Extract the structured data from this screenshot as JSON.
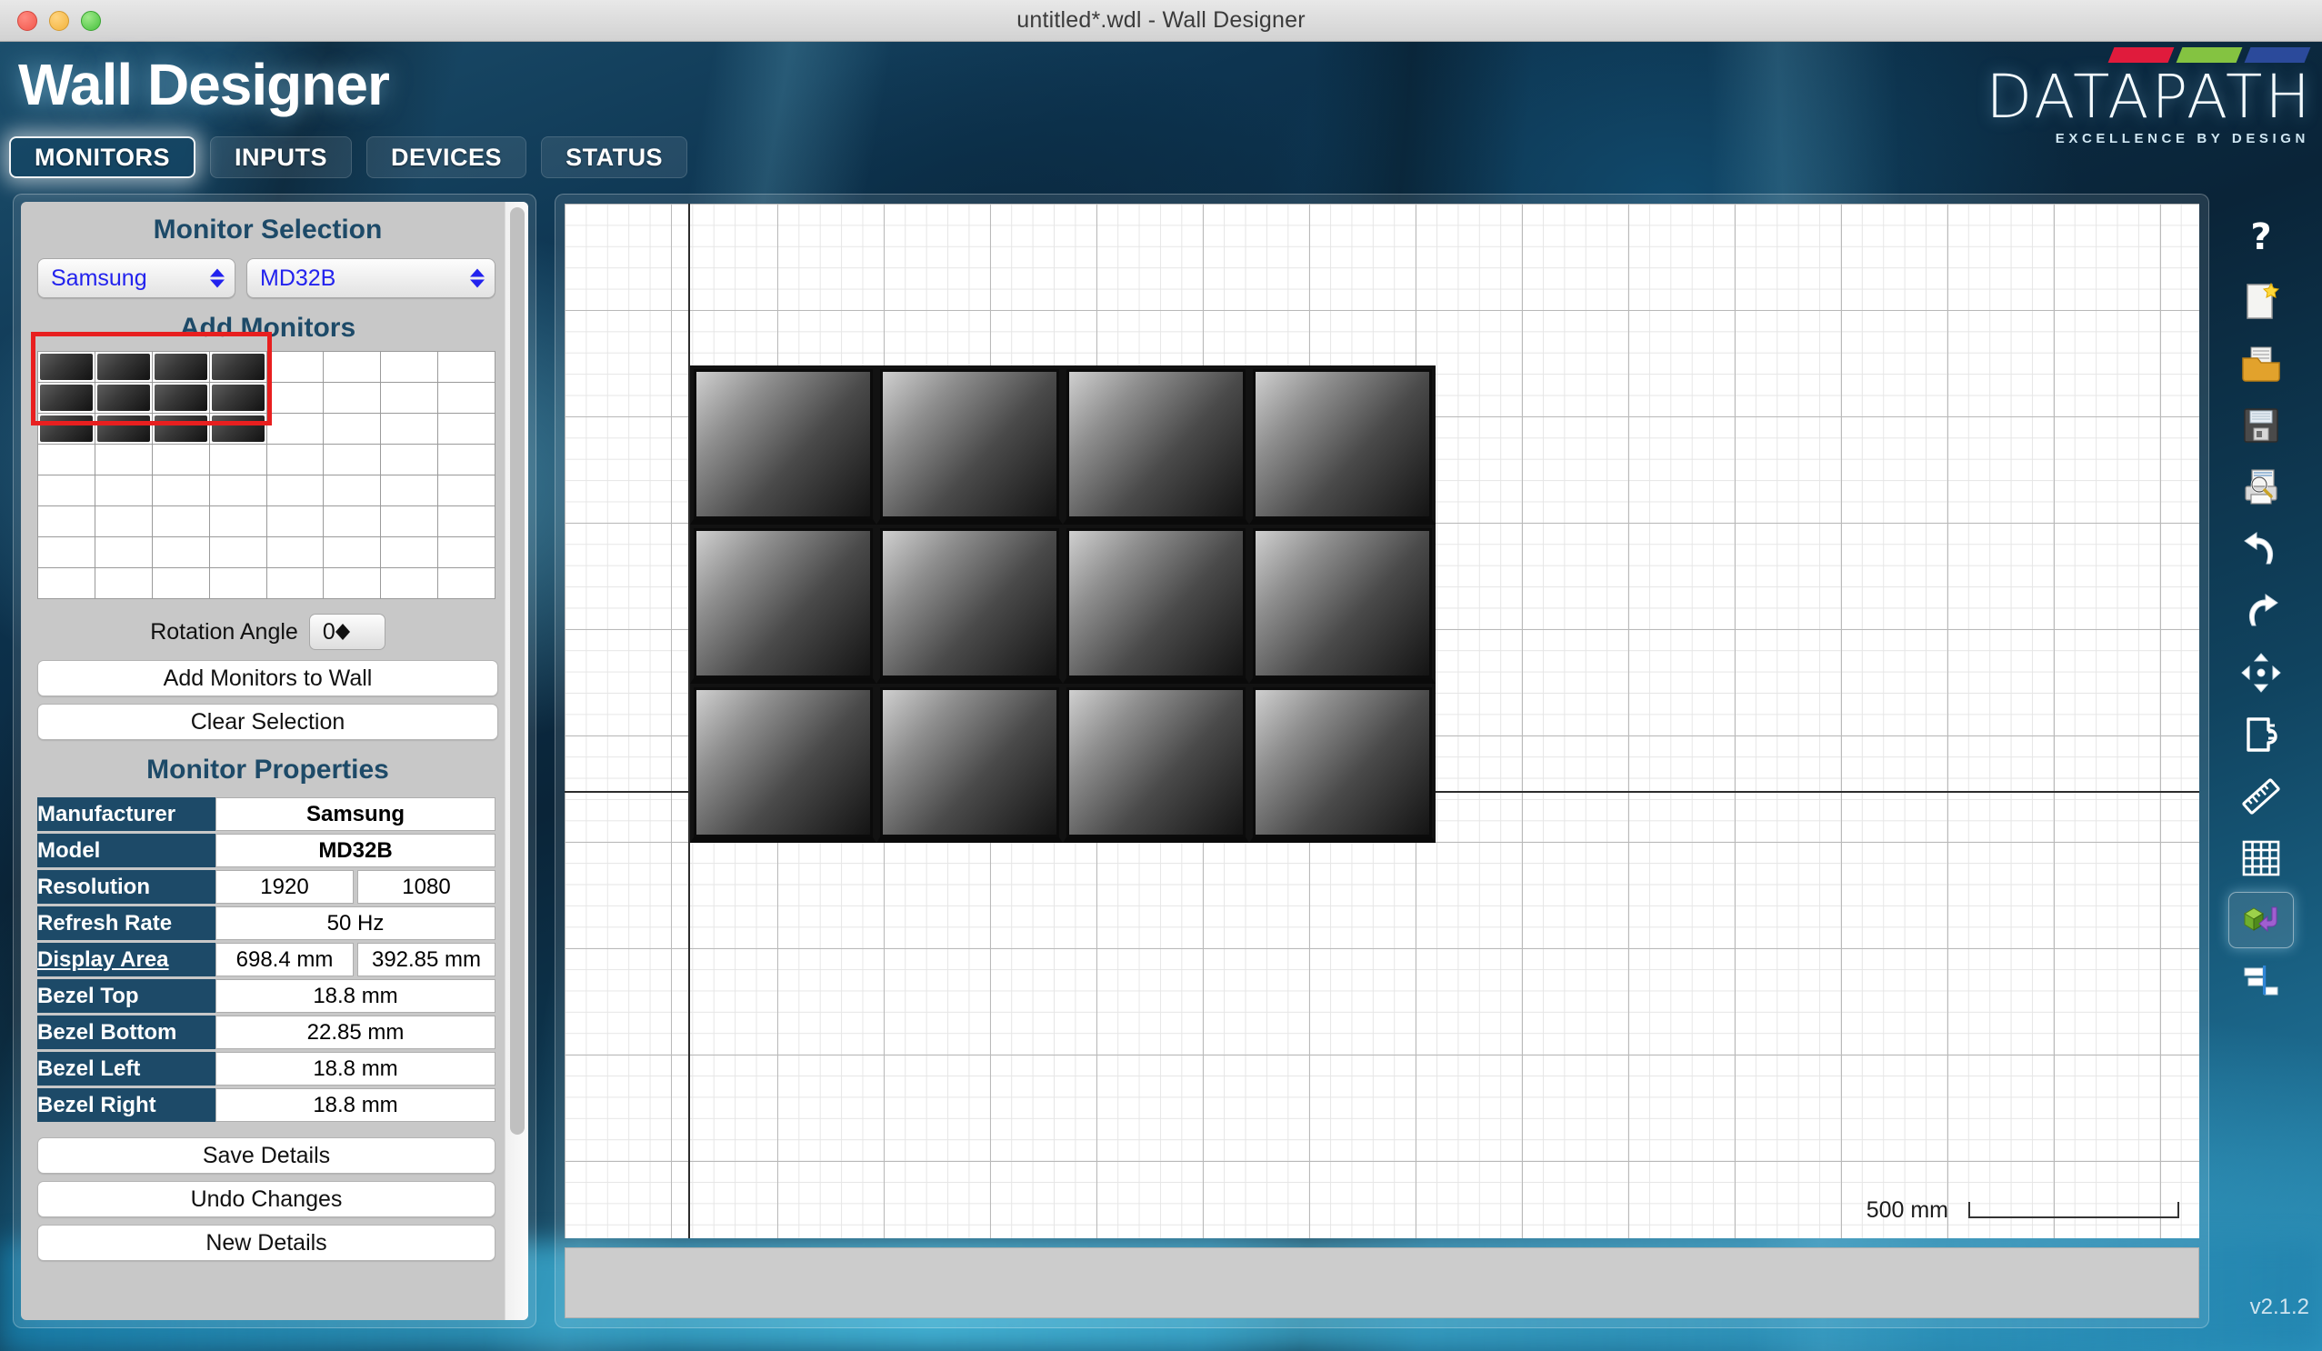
{
  "window": {
    "title": "untitled*.wdl - Wall Designer",
    "controls": [
      "close",
      "minimize",
      "maximize"
    ]
  },
  "header": {
    "app_title": "Wall Designer",
    "logo": {
      "wordmark": "DATAPATH",
      "tagline": "EXCELLENCE BY DESIGN",
      "bar_colors": [
        "#e01b3c",
        "#84c341",
        "#2b4a9b"
      ]
    }
  },
  "tabs": [
    {
      "label": "MONITORS",
      "active": true
    },
    {
      "label": "INPUTS",
      "active": false
    },
    {
      "label": "DEVICES",
      "active": false
    },
    {
      "label": "STATUS",
      "active": false
    }
  ],
  "sidebar": {
    "monitor_selection": {
      "heading": "Monitor Selection",
      "manufacturer": "Samsung",
      "model": "MD32B"
    },
    "add_monitors": {
      "heading": "Add Monitors",
      "grid_columns": 8,
      "grid_rows": 8,
      "filled_columns": 4,
      "filled_rows": 3,
      "selection_rect": {
        "cols": 4,
        "rows": 3
      },
      "selection_color": "#e81f1f",
      "rotation_label": "Rotation Angle",
      "rotation_value": "0",
      "add_button": "Add Monitors to Wall",
      "clear_button": "Clear Selection"
    },
    "monitor_properties": {
      "heading": "Monitor Properties",
      "rows": [
        {
          "label": "Manufacturer",
          "values": [
            "Samsung"
          ],
          "bold": true
        },
        {
          "label": "Model",
          "values": [
            "MD32B"
          ],
          "bold": true
        },
        {
          "label": "Resolution",
          "values": [
            "1920",
            "1080"
          ]
        },
        {
          "label": "Refresh Rate",
          "values": [
            "50 Hz"
          ]
        },
        {
          "label": "Display Area",
          "values": [
            "698.4 mm",
            "392.85 mm"
          ],
          "underline": true
        },
        {
          "label": "Bezel Top",
          "values": [
            "18.8 mm"
          ]
        },
        {
          "label": "Bezel Bottom",
          "values": [
            "22.85 mm"
          ]
        },
        {
          "label": "Bezel Left",
          "values": [
            "18.8 mm"
          ]
        },
        {
          "label": "Bezel Right",
          "values": [
            "18.8 mm"
          ]
        }
      ]
    },
    "actions": {
      "save": "Save Details",
      "undo": "Undo Changes",
      "new": "New Details"
    }
  },
  "canvas": {
    "wall": {
      "columns": 4,
      "rows": 3,
      "total_monitors": 12
    },
    "scale_label": "500 mm",
    "grid_visible": true
  },
  "toolbar": [
    {
      "name": "help-icon",
      "title": "Help"
    },
    {
      "name": "new-file-icon",
      "title": "New"
    },
    {
      "name": "open-folder-icon",
      "title": "Open"
    },
    {
      "name": "save-floppy-icon",
      "title": "Save"
    },
    {
      "name": "print-preview-icon",
      "title": "Print Preview"
    },
    {
      "name": "undo-icon",
      "title": "Undo"
    },
    {
      "name": "redo-icon",
      "title": "Redo"
    },
    {
      "name": "move-icon",
      "title": "Move"
    },
    {
      "name": "measure-jug-icon",
      "title": "Units"
    },
    {
      "name": "ruler-icon",
      "title": "Measure"
    },
    {
      "name": "grid-icon",
      "title": "Grid"
    },
    {
      "name": "cube-rotate-icon",
      "title": "3D View",
      "active": true
    },
    {
      "name": "align-right-icon",
      "title": "Align"
    }
  ],
  "version": "v2.1.2"
}
